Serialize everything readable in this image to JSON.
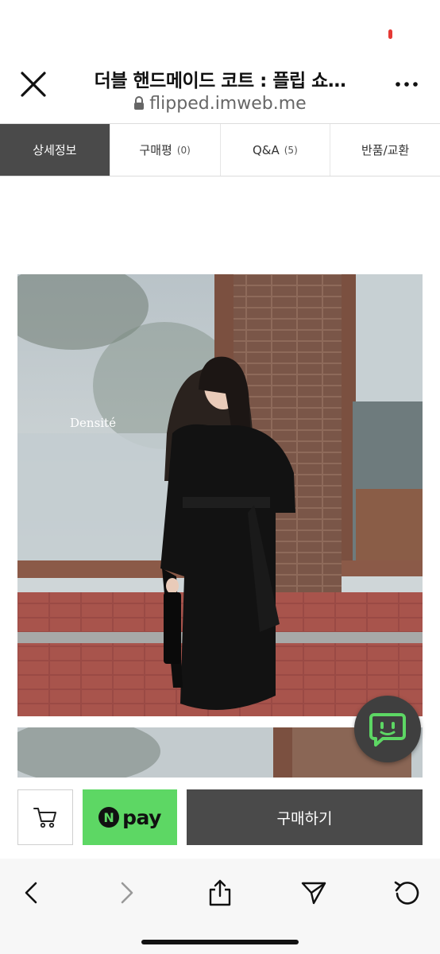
{
  "browser": {
    "page_title": "더블 핸드메이드 코트 : 플립 쇼…",
    "url": "flipped.imweb.me"
  },
  "tabs": [
    {
      "label": "상세정보",
      "count": ""
    },
    {
      "label": "구매평",
      "count": "(0)"
    },
    {
      "label": "Q&A",
      "count": "(5)"
    },
    {
      "label": "반품/교환",
      "count": ""
    }
  ],
  "product_photo": {
    "watermark": "Densité"
  },
  "purchase_bar": {
    "npay_label": "pay",
    "npay_logo_letter": "N",
    "purchase_label": "구매하기"
  },
  "icons": [
    "close-icon",
    "lock-icon",
    "more-icon",
    "cart-icon",
    "chat-icon",
    "back-icon",
    "forward-icon",
    "share-icon",
    "send-icon",
    "reload-icon"
  ],
  "colors": {
    "active_tab": "#4a4a4a",
    "npay_green": "#5dd764",
    "purchase_button": "#4a4a4a",
    "chat_fab": "#3f3f3f",
    "chat_fab_icon": "#5dd764"
  }
}
